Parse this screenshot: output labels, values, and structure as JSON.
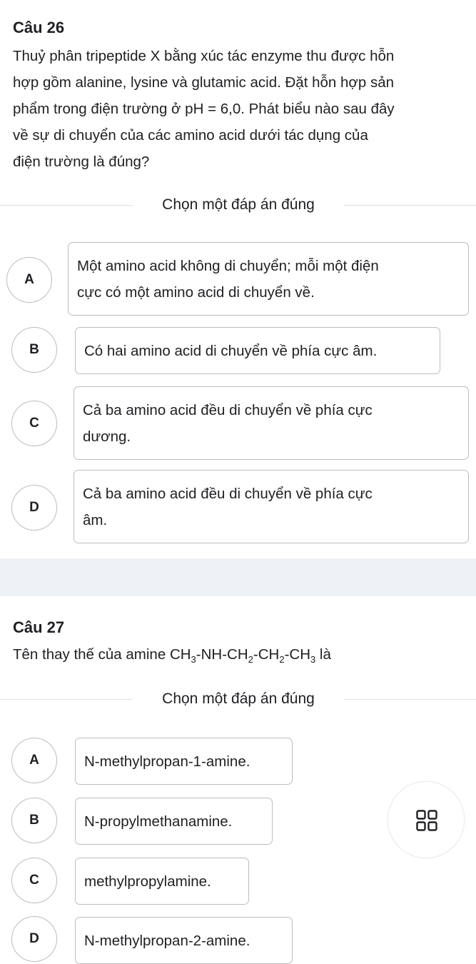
{
  "q26": {
    "title": "Câu 26",
    "lines": [
      "Thuỷ phân tripeptide X bằng xúc tác enzyme thu được hỗn",
      "hợp gồm alanine, lysine và glutamic acid. Đặt hỗn hợp sản",
      "phẩm trong điện trường ở pH = 6,0. Phát biểu nào sau đây",
      "về sự di chuyển của các amino acid dưới tác dụng của",
      "điện trường là đúng?"
    ],
    "prompt": "Chọn một đáp án đúng",
    "options": [
      {
        "letter": "A",
        "line1": "Một amino acid không di chuyển; mỗi một điện",
        "line2": "cực có một amino acid di chuyển về."
      },
      {
        "letter": "B",
        "line1": "Có hai amino acid di chuyển về phía cực âm.",
        "line2": ""
      },
      {
        "letter": "C",
        "line1": "Cả ba amino acid đều di chuyển về phía cực",
        "line2": "dương."
      },
      {
        "letter": "D",
        "line1": "Cả ba amino acid đều di chuyển về phía cực",
        "line2": "âm."
      }
    ]
  },
  "q27": {
    "title": "Câu 27",
    "text_prefix": "Tên thay thế của amine ",
    "formula": {
      "p1": "CH",
      "s1": "3",
      "p2": "-NH-CH",
      "s2": "2",
      "p3": "-CH",
      "s3": "2",
      "p4": "-CH",
      "s4": "3"
    },
    "text_suffix": " là",
    "prompt": "Chọn một đáp án đúng",
    "options": [
      {
        "letter": "A",
        "label": "N-methylpropan-1-amine."
      },
      {
        "letter": "B",
        "label": "N-propylmethanamine."
      },
      {
        "letter": "C",
        "label": "methylpropylamine."
      },
      {
        "letter": "D",
        "label": "N-methylpropan-2-amine."
      }
    ]
  },
  "fab": {
    "icon": "grid-icon"
  }
}
